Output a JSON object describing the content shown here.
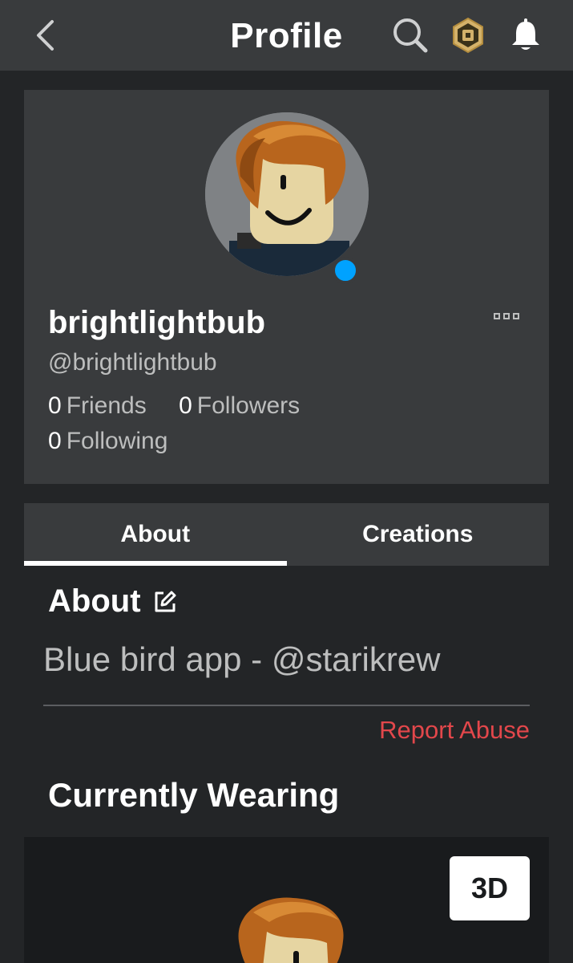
{
  "header": {
    "title": "Profile",
    "icons": [
      "chevron-left-icon",
      "search-icon",
      "robux-icon",
      "bell-icon"
    ]
  },
  "profile": {
    "display_name": "brightlightbub",
    "username": "@brightlightbub",
    "friends": {
      "count": "0",
      "label": "Friends"
    },
    "followers": {
      "count": "0",
      "label": "Followers"
    },
    "following": {
      "count": "0",
      "label": "Following"
    },
    "status_color": "#00a2ff"
  },
  "tabs": [
    {
      "label": "About",
      "active": true
    },
    {
      "label": "Creations",
      "active": false
    }
  ],
  "about": {
    "heading": "About",
    "text": "Blue bird app - @starikrew",
    "report_label": "Report Abuse"
  },
  "wearing": {
    "heading": "Currently Wearing",
    "view_3d_label": "3D"
  },
  "colors": {
    "background": "#232527",
    "card": "#393b3d",
    "accent_red": "#e2474b",
    "online_blue": "#00a2ff"
  }
}
